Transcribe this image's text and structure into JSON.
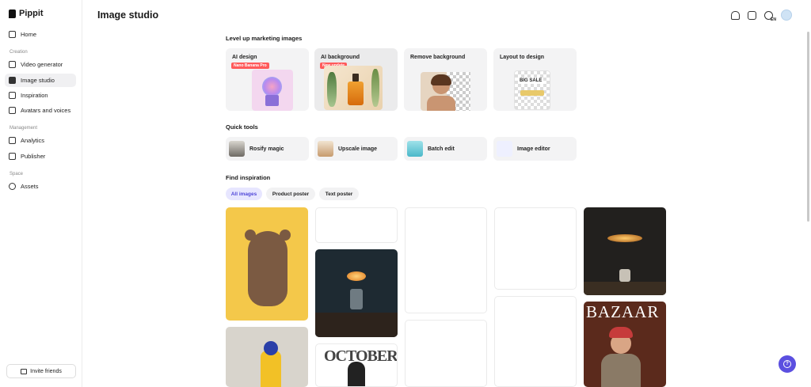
{
  "app": {
    "logo_text": "Pippit",
    "page_title": "Image studio"
  },
  "sidebar": {
    "items": [
      {
        "label": "Home",
        "icon": "home-icon"
      },
      {
        "label": "Video generator",
        "icon": "video-icon"
      },
      {
        "label": "Image studio",
        "icon": "image-icon",
        "active": true
      },
      {
        "label": "Inspiration",
        "icon": "lightbulb-icon"
      },
      {
        "label": "Avatars and voices",
        "icon": "avatar-icon"
      },
      {
        "label": "Analytics",
        "icon": "chart-icon"
      },
      {
        "label": "Publisher",
        "icon": "calendar-icon"
      },
      {
        "label": "Assets",
        "icon": "cloud-icon"
      }
    ],
    "sections": {
      "creation": "Creation",
      "management": "Management",
      "space": "Space"
    },
    "invite_label": "Invite friends"
  },
  "topbar": {
    "lang": "EN"
  },
  "marketing": {
    "title": "Level up marketing images",
    "cards": [
      {
        "label": "AI design",
        "badge": "Nano Banana Pro"
      },
      {
        "label": "AI background",
        "badge": "New update"
      },
      {
        "label": "Remove background"
      },
      {
        "label": "Layout to design",
        "sign_text": "BIG SALE"
      }
    ]
  },
  "quick_tools": {
    "title": "Quick tools",
    "items": [
      {
        "label": "Rosify magic"
      },
      {
        "label": "Upscale image"
      },
      {
        "label": "Batch edit"
      },
      {
        "label": "Image editor"
      }
    ]
  },
  "inspiration": {
    "title": "Find inspiration",
    "filters": [
      {
        "label": "All images",
        "active": true
      },
      {
        "label": "Product poster"
      },
      {
        "label": "Text poster"
      }
    ],
    "bazaar_text": "BAZAAR",
    "october_text": "OCTOBER"
  },
  "colors": {
    "accent": "#5b4fe0",
    "badge": "#ff5a5a",
    "chip_active_bg": "#e7e6ff"
  }
}
